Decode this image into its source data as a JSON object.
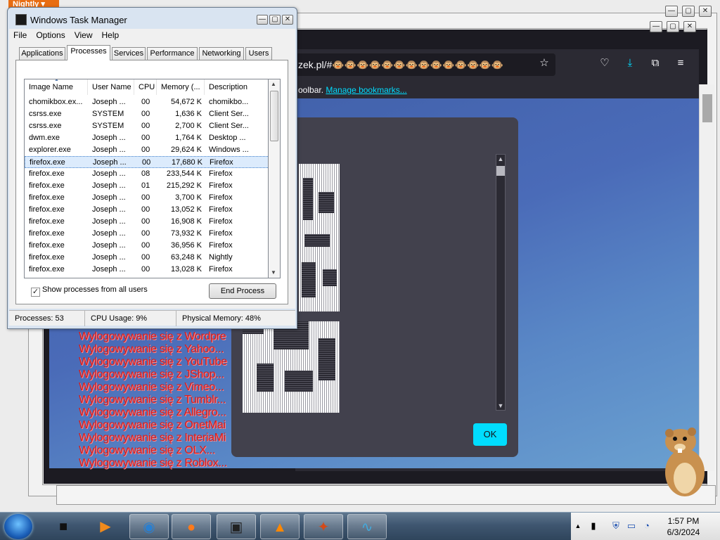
{
  "taskmanager": {
    "title": "Windows Task Manager",
    "menu": [
      "File",
      "Options",
      "View",
      "Help"
    ],
    "tabs": [
      "Applications",
      "Processes",
      "Services",
      "Performance",
      "Networking",
      "Users"
    ],
    "active_tab": "Processes",
    "columns": [
      "Image Name",
      "User Name",
      "CPU",
      "Memory (...",
      "Description"
    ],
    "rows": [
      {
        "image": "chomikbox.ex...",
        "user": "Joseph ...",
        "cpu": "00",
        "mem": "54,672 K",
        "desc": "chomikbo..."
      },
      {
        "image": "csrss.exe",
        "user": "SYSTEM",
        "cpu": "00",
        "mem": "1,636 K",
        "desc": "Client Ser..."
      },
      {
        "image": "csrss.exe",
        "user": "SYSTEM",
        "cpu": "00",
        "mem": "2,700 K",
        "desc": "Client Ser..."
      },
      {
        "image": "dwm.exe",
        "user": "Joseph ...",
        "cpu": "00",
        "mem": "1,764 K",
        "desc": "Desktop ..."
      },
      {
        "image": "explorer.exe",
        "user": "Joseph ...",
        "cpu": "00",
        "mem": "29,624 K",
        "desc": "Windows ..."
      },
      {
        "image": "firefox.exe",
        "user": "Joseph ...",
        "cpu": "00",
        "mem": "17,680 K",
        "desc": "Firefox"
      },
      {
        "image": "firefox.exe",
        "user": "Joseph ...",
        "cpu": "08",
        "mem": "233,544 K",
        "desc": "Firefox"
      },
      {
        "image": "firefox.exe",
        "user": "Joseph ...",
        "cpu": "01",
        "mem": "215,292 K",
        "desc": "Firefox"
      },
      {
        "image": "firefox.exe",
        "user": "Joseph ...",
        "cpu": "00",
        "mem": "3,700 K",
        "desc": "Firefox"
      },
      {
        "image": "firefox.exe",
        "user": "Joseph ...",
        "cpu": "00",
        "mem": "13,052 K",
        "desc": "Firefox"
      },
      {
        "image": "firefox.exe",
        "user": "Joseph ...",
        "cpu": "00",
        "mem": "16,908 K",
        "desc": "Firefox"
      },
      {
        "image": "firefox.exe",
        "user": "Joseph ...",
        "cpu": "00",
        "mem": "73,932 K",
        "desc": "Firefox"
      },
      {
        "image": "firefox.exe",
        "user": "Joseph ...",
        "cpu": "00",
        "mem": "36,956 K",
        "desc": "Firefox"
      },
      {
        "image": "firefox.exe",
        "user": "Joseph ...",
        "cpu": "00",
        "mem": "63,248 K",
        "desc": "Nightly"
      },
      {
        "image": "firefox.exe",
        "user": "Joseph ...",
        "cpu": "00",
        "mem": "13,028 K",
        "desc": "Firefox"
      }
    ],
    "selected_row": 5,
    "show_all_label": "Show processes from all users",
    "show_all_checked": true,
    "end_process_label": "End Process",
    "status": {
      "processes": "Processes: 53",
      "cpu": "CPU Usage: 9%",
      "memory": "Physical Memory: 48%"
    }
  },
  "nightly_tab": "Nightly",
  "browser": {
    "url": "zek.pl/#🐵🐵🐵🐵🐵🐵🐵🐵🐵🐵🐵🐵🐵🐵",
    "bookmark_bar_text": "oolbar.",
    "manage_bookmarks": "Manage bookmarks...",
    "accent": "#00ddff"
  },
  "logout_lines": [
    "Wylogowywanie się z Wordpre",
    "Wylogowywanie się z Yahoo...",
    "Wylogowywanie się z YouTube",
    "Wylogowywanie się z JShop...",
    "Wylogowywanie się z Vimeo...",
    "Wylogowywanie się z Tumblr...",
    "Wylogowywanie się z Allegro...",
    "Wylogowywanie się z OnetMai",
    "Wylogowywanie się z InteriaMi",
    "Wylogowywanie się z OLX...",
    "Wylogowywanie się z Roblox..."
  ],
  "dialog": {
    "ok_label": "OK"
  },
  "taskbar": {
    "time": "1:57 PM",
    "date": "6/3/2024"
  }
}
